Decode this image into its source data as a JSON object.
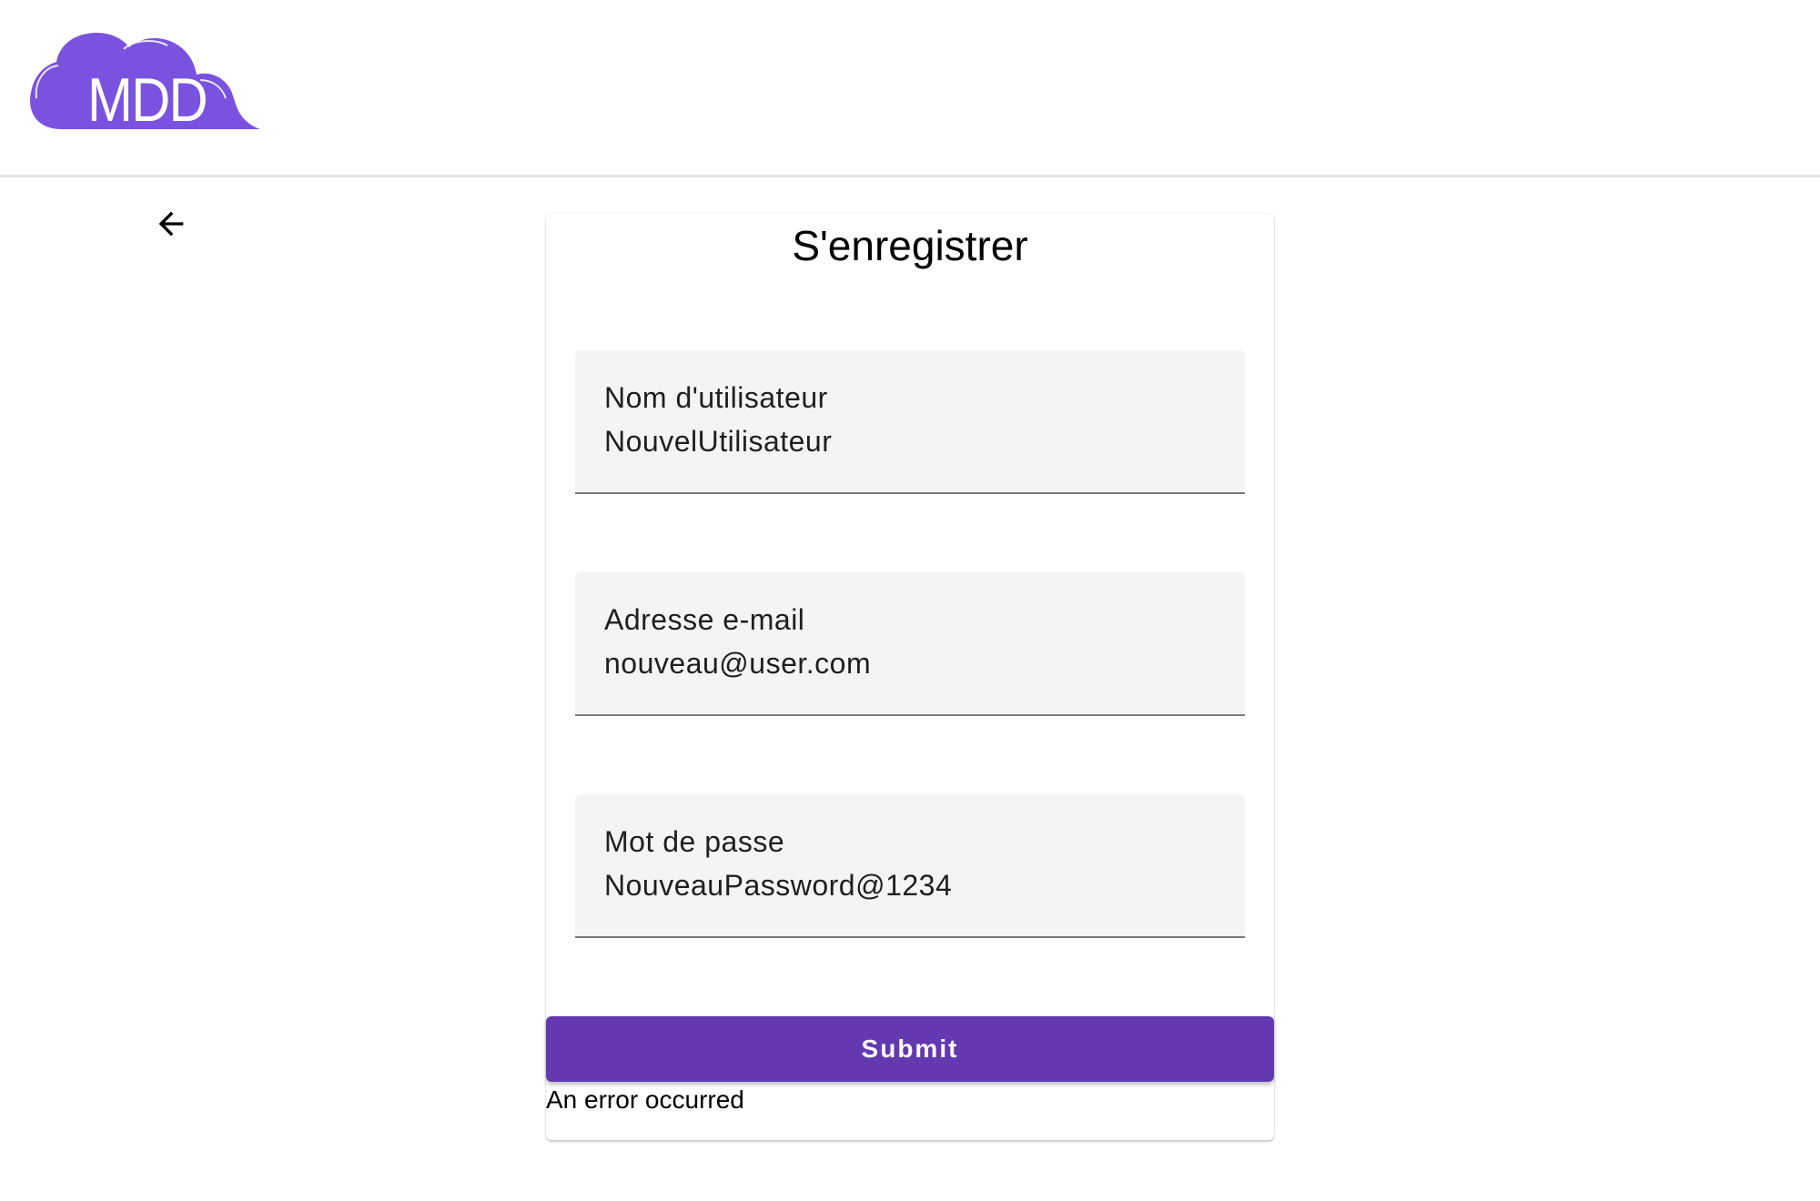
{
  "header": {
    "logo_text": "MDD",
    "logo_color": "#7a52e0"
  },
  "nav": {
    "back_icon": "arrow-left-icon"
  },
  "register_form": {
    "title": "S'enregistrer",
    "username": {
      "label": "Nom d'utilisateur",
      "value": "NouvelUtilisateur"
    },
    "email": {
      "label": "Adresse e-mail",
      "value": "nouveau@user.com"
    },
    "password": {
      "label": "Mot de passe",
      "value": "NouveauPassword@1234"
    },
    "submit_label": "Submit",
    "submit_color": "#6338b1",
    "error_message": "An error occurred"
  }
}
